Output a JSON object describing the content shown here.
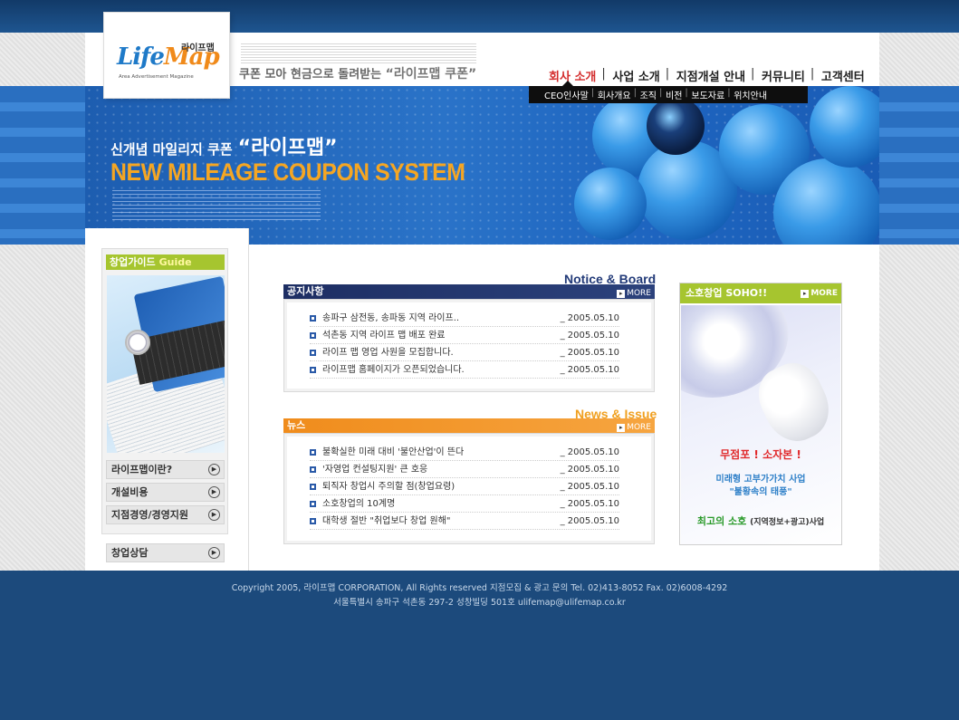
{
  "header": {
    "logo_text_main": "LifeMap",
    "logo_text_kr": "라이프맵",
    "logo_sub": "Area Advertisement Magazine",
    "slogan_pre": "쿠폰 모아 현금으로 돌려받는",
    "slogan_quote": "“라이프맵 쿠폰”"
  },
  "gnb": {
    "items": [
      "회사 소개",
      "사업 소개",
      "지점개설 안내",
      "커뮤니티",
      "고객센터"
    ]
  },
  "subnav": {
    "items": [
      "CEO인사말",
      "회사개요",
      "조직",
      "비전",
      "보도자료",
      "위치안내"
    ]
  },
  "banner": {
    "kr_line_pre": "신개념 마일리지 쿠폰",
    "kr_line_big": "“라이프맵”",
    "en_line": "NEW MILEAGE COUPON SYSTEM"
  },
  "sidebar": {
    "title_kr": "창업가이드",
    "title_en": "Guide",
    "buttons": [
      "라이프맵이란?",
      "개설비용",
      "지점경영/경영지원",
      "창업상담"
    ]
  },
  "notice": {
    "caption": "Notice & Board",
    "head": "공지사항",
    "more": "MORE",
    "rows": [
      {
        "title": "송파구 삼전동, 송파동 지역 라이프..",
        "date": "_ 2005.05.10"
      },
      {
        "title": "석촌동 지역 라이프 맵 배포 완료",
        "date": "_ 2005.05.10"
      },
      {
        "title": "라이프 맵 영업 사원을 모집합니다.",
        "date": "_ 2005.05.10"
      },
      {
        "title": "라이프맵 홈페이지가 오픈되었습니다.",
        "date": "_ 2005.05.10"
      }
    ]
  },
  "news": {
    "caption": "News & Issue",
    "head": "뉴스",
    "more": "MORE",
    "rows": [
      {
        "title": "불확실한 미래 대비 '불안산업'이 뜬다",
        "date": "_ 2005.05.10"
      },
      {
        "title": " '자영업 컨설팅지원' 큰 호응",
        "date": "_ 2005.05.10"
      },
      {
        "title": "퇴직자 창업시 주의할 점(창업요령)",
        "date": "_ 2005.05.10"
      },
      {
        "title": "소호창업의 10계명",
        "date": "_ 2005.05.10"
      },
      {
        "title": "대학생 절반 \"취업보다 창업 원해\"",
        "date": "_ 2005.05.10"
      }
    ]
  },
  "soho": {
    "title_kr": "소호창업",
    "title_en": "SOHO!!",
    "more": "MORE",
    "line1": "무점포 ! 소자본 !",
    "line2a": "미래형 고부가가치 사업",
    "line2b": "\"불황속의 태풍\"",
    "line3": "최고의 소호",
    "line3_small": "(지역정보+광고)사업"
  },
  "footer": {
    "line1": "Copyright  2005, 라이프맵  CORPORATION,  All Rights reserved    지점모집 & 광고 문의  Tel. 02)413-8052    Fax. 02)6008-4292",
    "line2": "서울특별시 송파구 석촌동 297-2 성창빌딩 501호   ulifemap@ulifemap.co.kr"
  },
  "colors": {
    "accent_green": "#a6c52f",
    "notice_navy": "#1d2e63",
    "news_orange": "#f08c1c",
    "banner_orange": "#f5a623",
    "active_red": "#d32c2c"
  }
}
